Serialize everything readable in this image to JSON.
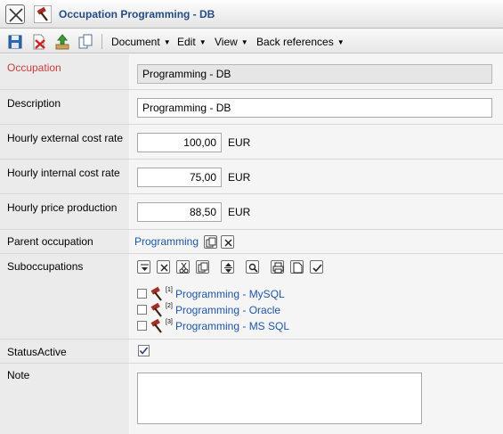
{
  "window": {
    "title": "Occupation Programming - DB"
  },
  "toolbar": {
    "menus": [
      "Document",
      "Edit",
      "View",
      "Back references"
    ]
  },
  "form": {
    "occupation": {
      "label": "Occupation",
      "value": "Programming - DB"
    },
    "description": {
      "label": "Description",
      "value": "Programming - DB"
    },
    "external_rate": {
      "label": "Hourly external cost rate",
      "value": "100,00",
      "unit": "EUR"
    },
    "internal_rate": {
      "label": "Hourly internal cost rate",
      "value": "75,00",
      "unit": "EUR"
    },
    "price_production": {
      "label": "Hourly price production",
      "value": "88,50",
      "unit": "EUR"
    },
    "parent": {
      "label": "Parent occupation",
      "value": "Programming"
    },
    "suboccupations": {
      "label": "Suboccupations",
      "items": [
        {
          "index": "[1]",
          "name": "Programming - MySQL",
          "checked": false
        },
        {
          "index": "[2]",
          "name": "Programming - Oracle",
          "checked": false
        },
        {
          "index": "[3]",
          "name": "Programming - MS SQL",
          "checked": false
        }
      ]
    },
    "status": {
      "label": "StatusActive",
      "checked": true
    },
    "note": {
      "label": "Note",
      "value": ""
    }
  },
  "colors": {
    "required_label": "#c83c3c",
    "link": "#1e56a8",
    "title": "#254c82"
  }
}
